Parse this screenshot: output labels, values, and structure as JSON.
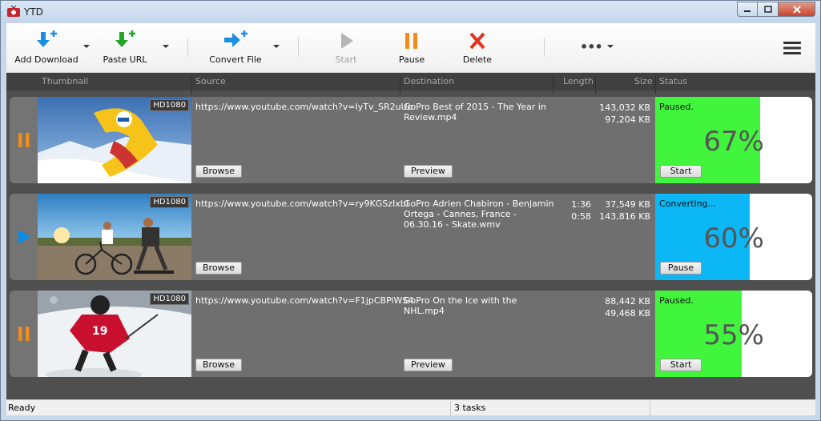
{
  "window": {
    "title": "YTD"
  },
  "toolbar": {
    "add_download": "Add Download",
    "paste_url": "Paste URL",
    "convert_file": "Convert File",
    "start": "Start",
    "pause": "Pause",
    "delete": "Delete",
    "more": "•••"
  },
  "columns": {
    "thumbnail": "Thumbnail",
    "source": "Source",
    "destination": "Destination",
    "length": "Length",
    "size": "Size",
    "status": "Status"
  },
  "rows": [
    {
      "badge": "HD1080",
      "source": "https://www.youtube.com/watch?v=IyTv_SR2uUo",
      "destination": "GoPro  Best of 2015 - The Year in Review.mp4",
      "length1": "",
      "length2": "",
      "size1": "143,032 KB",
      "size2": "97,204 KB",
      "left_button": "Browse",
      "right_button": "Preview",
      "status_text": "Paused.",
      "percent": "67%",
      "progress": 0.67,
      "status_button": "Start",
      "fill_color": "#41f53c",
      "state_icon": "pause-icon"
    },
    {
      "badge": "HD1080",
      "source": "https://www.youtube.com/watch?v=ry9KGSzIxbI",
      "destination": "GoPro  Adrien Chabiron - Benjamin Ortega - Cannes, France - 06.30.16 - Skate.wmv",
      "length1": "1:36",
      "length2": "0:58",
      "size1": "37,549 KB",
      "size2": "143,816 KB",
      "left_button": "Browse",
      "right_button": "",
      "status_text": "Converting...",
      "percent": "60%",
      "progress": 0.6,
      "status_button": "Pause",
      "fill_color": "#0bb7f5",
      "state_icon": "play-icon"
    },
    {
      "badge": "HD1080",
      "source": "https://www.youtube.com/watch?v=F1jpCBPiWS4",
      "destination": "GoPro  On the Ice with the NHL.mp4",
      "length1": "",
      "length2": "",
      "size1": "88,442 KB",
      "size2": "49,468 KB",
      "left_button": "Browse",
      "right_button": "Preview",
      "status_text": "Paused.",
      "percent": "55%",
      "progress": 0.55,
      "status_button": "Start",
      "fill_color": "#41f53c",
      "state_icon": "pause-icon"
    }
  ],
  "statusbar": {
    "ready": "Ready",
    "tasks": "3 tasks"
  }
}
